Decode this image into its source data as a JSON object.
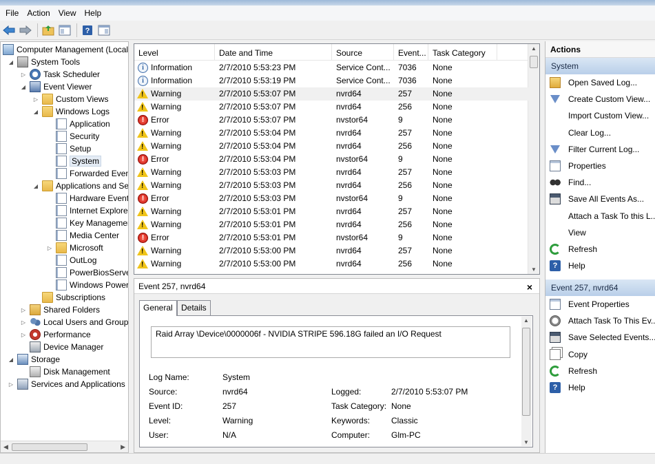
{
  "menu": [
    "File",
    "Action",
    "View",
    "Help"
  ],
  "toolbar": {
    "buttons": [
      "back-arrow-icon",
      "forward-arrow-icon",
      "up-folder-icon",
      "show-hide-tree-icon",
      "help-icon",
      "show-hide-action-pane-icon"
    ]
  },
  "tree": [
    {
      "label": "Computer Management (Local",
      "indent": 0,
      "exp": "",
      "icon": "comp"
    },
    {
      "label": "System Tools",
      "indent": 1,
      "exp": "◢",
      "icon": "tools"
    },
    {
      "label": "Task Scheduler",
      "indent": 2,
      "exp": "▷",
      "icon": "clock"
    },
    {
      "label": "Event Viewer",
      "indent": 2,
      "exp": "◢",
      "icon": "viewer"
    },
    {
      "label": "Custom Views",
      "indent": 3,
      "exp": "▷",
      "icon": "folder"
    },
    {
      "label": "Windows Logs",
      "indent": 3,
      "exp": "◢",
      "icon": "folder"
    },
    {
      "label": "Application",
      "indent": 4,
      "exp": "",
      "icon": "log"
    },
    {
      "label": "Security",
      "indent": 4,
      "exp": "",
      "icon": "log"
    },
    {
      "label": "Setup",
      "indent": 4,
      "exp": "",
      "icon": "log"
    },
    {
      "label": "System",
      "indent": 4,
      "exp": "",
      "icon": "log",
      "selected": true
    },
    {
      "label": "Forwarded Event",
      "indent": 4,
      "exp": "",
      "icon": "log"
    },
    {
      "label": "Applications and Se",
      "indent": 3,
      "exp": "◢",
      "icon": "folder"
    },
    {
      "label": "Hardware Events",
      "indent": 4,
      "exp": "",
      "icon": "log"
    },
    {
      "label": "Internet Explorer",
      "indent": 4,
      "exp": "",
      "icon": "log"
    },
    {
      "label": "Key Managemen",
      "indent": 4,
      "exp": "",
      "icon": "log"
    },
    {
      "label": "Media Center",
      "indent": 4,
      "exp": "",
      "icon": "log"
    },
    {
      "label": "Microsoft",
      "indent": 4,
      "exp": "▷",
      "icon": "folder"
    },
    {
      "label": "OutLog",
      "indent": 4,
      "exp": "",
      "icon": "log"
    },
    {
      "label": "PowerBiosServer",
      "indent": 4,
      "exp": "",
      "icon": "log"
    },
    {
      "label": "Windows Power",
      "indent": 4,
      "exp": "",
      "icon": "log"
    },
    {
      "label": "Subscriptions",
      "indent": 3,
      "exp": "",
      "icon": "folder"
    },
    {
      "label": "Shared Folders",
      "indent": 2,
      "exp": "▷",
      "icon": "share"
    },
    {
      "label": "Local Users and Groups",
      "indent": 2,
      "exp": "▷",
      "icon": "users"
    },
    {
      "label": "Performance",
      "indent": 2,
      "exp": "▷",
      "icon": "perf"
    },
    {
      "label": "Device Manager",
      "indent": 2,
      "exp": "",
      "icon": "dev"
    },
    {
      "label": "Storage",
      "indent": 1,
      "exp": "◢",
      "icon": "storage"
    },
    {
      "label": "Disk Management",
      "indent": 2,
      "exp": "",
      "icon": "disk"
    },
    {
      "label": "Services and Applications",
      "indent": 1,
      "exp": "▷",
      "icon": "svc"
    }
  ],
  "events": {
    "columns": [
      "Level",
      "Date and Time",
      "Source",
      "Event...",
      "Task Category"
    ],
    "rows": [
      {
        "level": "Information",
        "type": "info",
        "date": "2/7/2010 5:53:23 PM",
        "source": "Service Cont...",
        "id": "7036",
        "cat": "None"
      },
      {
        "level": "Information",
        "type": "info",
        "date": "2/7/2010 5:53:19 PM",
        "source": "Service Cont...",
        "id": "7036",
        "cat": "None"
      },
      {
        "level": "Warning",
        "type": "warn",
        "date": "2/7/2010 5:53:07 PM",
        "source": "nvrd64",
        "id": "257",
        "cat": "None",
        "selected": true
      },
      {
        "level": "Warning",
        "type": "warn",
        "date": "2/7/2010 5:53:07 PM",
        "source": "nvrd64",
        "id": "256",
        "cat": "None"
      },
      {
        "level": "Error",
        "type": "err",
        "date": "2/7/2010 5:53:07 PM",
        "source": "nvstor64",
        "id": "9",
        "cat": "None"
      },
      {
        "level": "Warning",
        "type": "warn",
        "date": "2/7/2010 5:53:04 PM",
        "source": "nvrd64",
        "id": "257",
        "cat": "None"
      },
      {
        "level": "Warning",
        "type": "warn",
        "date": "2/7/2010 5:53:04 PM",
        "source": "nvrd64",
        "id": "256",
        "cat": "None"
      },
      {
        "level": "Error",
        "type": "err",
        "date": "2/7/2010 5:53:04 PM",
        "source": "nvstor64",
        "id": "9",
        "cat": "None"
      },
      {
        "level": "Warning",
        "type": "warn",
        "date": "2/7/2010 5:53:03 PM",
        "source": "nvrd64",
        "id": "257",
        "cat": "None"
      },
      {
        "level": "Warning",
        "type": "warn",
        "date": "2/7/2010 5:53:03 PM",
        "source": "nvrd64",
        "id": "256",
        "cat": "None"
      },
      {
        "level": "Error",
        "type": "err",
        "date": "2/7/2010 5:53:03 PM",
        "source": "nvstor64",
        "id": "9",
        "cat": "None"
      },
      {
        "level": "Warning",
        "type": "warn",
        "date": "2/7/2010 5:53:01 PM",
        "source": "nvrd64",
        "id": "257",
        "cat": "None"
      },
      {
        "level": "Warning",
        "type": "warn",
        "date": "2/7/2010 5:53:01 PM",
        "source": "nvrd64",
        "id": "256",
        "cat": "None"
      },
      {
        "level": "Error",
        "type": "err",
        "date": "2/7/2010 5:53:01 PM",
        "source": "nvstor64",
        "id": "9",
        "cat": "None"
      },
      {
        "level": "Warning",
        "type": "warn",
        "date": "2/7/2010 5:53:00 PM",
        "source": "nvrd64",
        "id": "257",
        "cat": "None"
      },
      {
        "level": "Warning",
        "type": "warn",
        "date": "2/7/2010 5:53:00 PM",
        "source": "nvrd64",
        "id": "256",
        "cat": "None"
      }
    ]
  },
  "detail": {
    "title": "Event 257, nvrd64",
    "close": "×",
    "tab_general": "General",
    "tab_details": "Details",
    "message": "Raid Array \\Device\\0000006f - NVIDIA  STRIPE   596.18G failed an I/O Request",
    "log_name_label": "Log Name:",
    "log_name": "System",
    "source_label": "Source:",
    "source": "nvrd64",
    "logged_label": "Logged:",
    "logged": "2/7/2010 5:53:07 PM",
    "event_id_label": "Event ID:",
    "event_id": "257",
    "task_cat_label": "Task Category:",
    "task_cat": "None",
    "level_label": "Level:",
    "level": "Warning",
    "keywords_label": "Keywords:",
    "keywords": "Classic",
    "user_label": "User:",
    "user": "N/A",
    "computer_label": "Computer:",
    "computer": "Glm-PC"
  },
  "actions": {
    "title": "Actions",
    "section1": "System",
    "items1": [
      {
        "label": "Open Saved Log...",
        "icon": "open"
      },
      {
        "label": "Create Custom View...",
        "icon": "filter"
      },
      {
        "label": "Import Custom View...",
        "icon": "none"
      },
      {
        "label": "Clear Log...",
        "icon": "none"
      },
      {
        "label": "Filter Current Log...",
        "icon": "filter"
      },
      {
        "label": "Properties",
        "icon": "props"
      },
      {
        "label": "Find...",
        "icon": "find"
      },
      {
        "label": "Save All Events As...",
        "icon": "save"
      },
      {
        "label": "Attach a Task To this L...",
        "icon": "none"
      },
      {
        "label": "View",
        "icon": "none"
      },
      {
        "label": "Refresh",
        "icon": "refresh"
      },
      {
        "label": "Help",
        "icon": "help"
      }
    ],
    "section2": "Event 257, nvrd64",
    "items2": [
      {
        "label": "Event Properties",
        "icon": "props"
      },
      {
        "label": "Attach Task To This Ev...",
        "icon": "attach"
      },
      {
        "label": "Save Selected Events...",
        "icon": "save"
      },
      {
        "label": "Copy",
        "icon": "copy"
      },
      {
        "label": "Refresh",
        "icon": "refresh"
      },
      {
        "label": "Help",
        "icon": "help"
      }
    ]
  },
  "colors": {
    "selection": "#e5ecf5",
    "section_header": "#c6d9ee",
    "warning": "#f0c419",
    "error": "#c4120a",
    "info": "#2a5ea0"
  }
}
